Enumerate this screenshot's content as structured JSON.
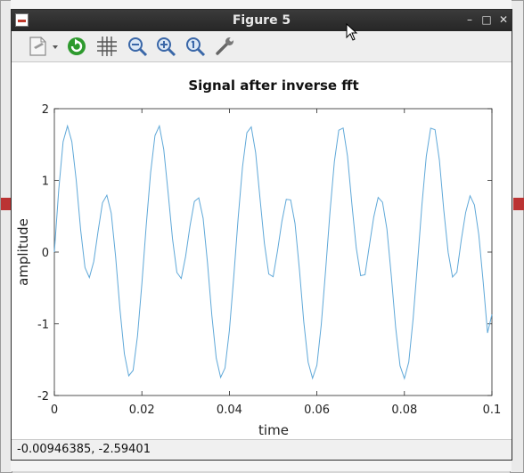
{
  "window": {
    "title": "Figure 5"
  },
  "window_controls": {
    "minimize": "–",
    "maximize": "□",
    "close": "✕"
  },
  "toolbar": {
    "items": [
      {
        "name": "new-figure-icon",
        "type": "document-with-dropdown"
      },
      {
        "name": "refresh-icon",
        "type": "green-circular-arrow"
      },
      {
        "name": "grid-icon",
        "type": "grid"
      },
      {
        "name": "zoom-out-icon",
        "type": "magnifier-minus"
      },
      {
        "name": "zoom-in-icon",
        "type": "magnifier-plus"
      },
      {
        "name": "zoom-reset-icon",
        "type": "magnifier-1"
      },
      {
        "name": "settings-icon",
        "type": "wrench"
      }
    ]
  },
  "colors": {
    "line": "#5fa8d8",
    "titlebar": "#2f2f2f"
  },
  "status": {
    "text": "-0.00946385, -2.59401"
  },
  "chart_data": {
    "type": "line",
    "title": "Signal after inverse fft",
    "xlabel": "time",
    "ylabel": "amplitude",
    "xlim": [
      0,
      0.1
    ],
    "ylim": [
      -2,
      2
    ],
    "xticks": [
      "0",
      "0.02",
      "0.04",
      "0.06",
      "0.08",
      "0.1"
    ],
    "yticks": [
      "-2",
      "-1",
      "0",
      "1",
      "2"
    ],
    "grid": false,
    "sample_rate": 1000,
    "series": [
      {
        "x": [
          0,
          0.001,
          0.002,
          0.003,
          0.004,
          0.005,
          0.006,
          0.007,
          0.008,
          0.009,
          0.01,
          0.011,
          0.012,
          0.013,
          0.014,
          0.015,
          0.016,
          0.017,
          0.018,
          0.019,
          0.02,
          0.021,
          0.022,
          0.023,
          0.024,
          0.025,
          0.026,
          0.027,
          0.028,
          0.029,
          0.03,
          0.031,
          0.032,
          0.033,
          0.034,
          0.035,
          0.036,
          0.037,
          0.038,
          0.039,
          0.04,
          0.041,
          0.042,
          0.043,
          0.044,
          0.045,
          0.046,
          0.047,
          0.048,
          0.049,
          0.05,
          0.051,
          0.052,
          0.053,
          0.054,
          0.055,
          0.056,
          0.057,
          0.058,
          0.059,
          0.06,
          0.061,
          0.062,
          0.063,
          0.064,
          0.065,
          0.066,
          0.067,
          0.068,
          0.069,
          0.07,
          0.071,
          0.072,
          0.073,
          0.074,
          0.075,
          0.076,
          0.077,
          0.078,
          0.079,
          0.08,
          0.081,
          0.082,
          0.083,
          0.084,
          0.085,
          0.086,
          0.087,
          0.088,
          0.089,
          0.09,
          0.091,
          0.092,
          0.093,
          0.094,
          0.095,
          0.096,
          0.097,
          0.098,
          0.099,
          0.1
        ],
        "y": [
          0,
          0.869,
          1.539,
          1.76,
          1.539,
          1.0,
          0.315,
          -0.216,
          -0.355,
          -0.132,
          0.294,
          0.688,
          0.793,
          0.543,
          -0.065,
          -0.802,
          -1.419,
          -1.726,
          -1.649,
          -1.171,
          -0.442,
          0.375,
          1.109,
          1.626,
          1.759,
          1.432,
          0.827,
          0.187,
          -0.284,
          -0.369,
          -0.059,
          0.364,
          0.706,
          0.756,
          0.472,
          -0.151,
          -0.888,
          -1.48,
          -1.748,
          -1.617,
          -1.094,
          -0.346,
          0.471,
          1.188,
          1.665,
          1.746,
          1.387,
          0.749,
          0.122,
          -0.306,
          -0.344,
          0.018,
          0.427,
          0.736,
          0.728,
          0.399,
          -0.238,
          -0.971,
          -1.535,
          -1.759,
          -1.578,
          -1.011,
          -0.249,
          0.565,
          1.264,
          1.699,
          1.73,
          1.336,
          0.668,
          0.056,
          -0.329,
          -0.315,
          0.094,
          0.491,
          0.762,
          0.695,
          0.322,
          -0.326,
          -1.051,
          -1.585,
          -1.763,
          -1.533,
          -0.925,
          -0.153,
          0.655,
          1.334,
          1.728,
          1.707,
          1.281,
          0.585,
          -0.004,
          -0.348,
          -0.28,
          0.17,
          0.552,
          0.785,
          0.658,
          0.241,
          -0.414,
          -1.128,
          -0.87
        ]
      }
    ]
  }
}
